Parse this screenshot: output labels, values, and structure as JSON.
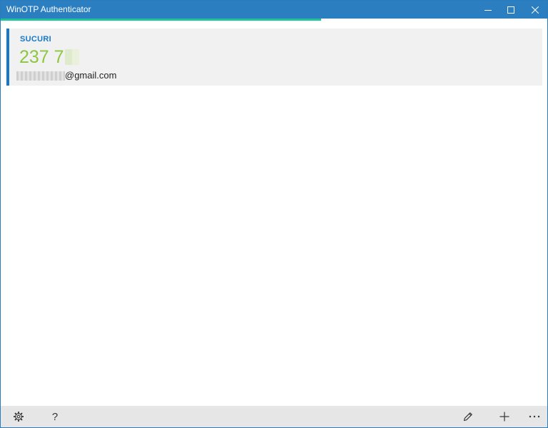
{
  "window": {
    "title": "WinOTP Authenticator",
    "accent_color": "#2b7fc1"
  },
  "timer": {
    "remaining_fraction": 0.586,
    "color": "#1ec59a"
  },
  "accounts": [
    {
      "issuer": "SUCURI",
      "code_visible": "237 7",
      "account_visible": "@gmail.com",
      "issuer_color": "#1678c8",
      "code_color": "#8dc63f"
    }
  ],
  "appbar": {
    "buttons": [
      "gear-icon",
      "help-icon",
      "pencil-icon",
      "plus-icon",
      "more-icon"
    ],
    "help_glyph": "?"
  }
}
